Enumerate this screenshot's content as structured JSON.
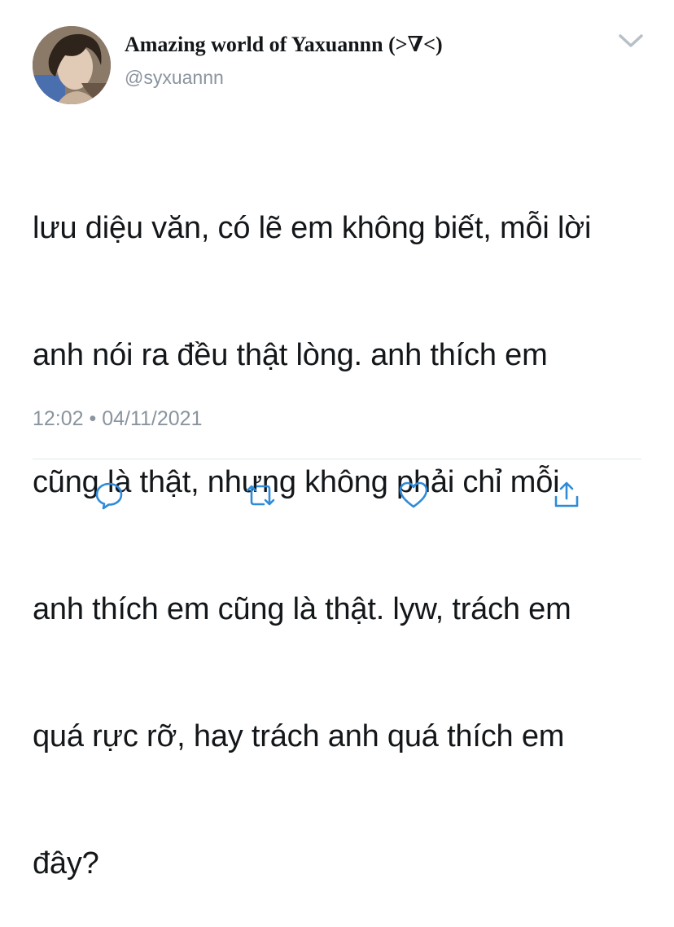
{
  "tweet": {
    "author": {
      "display_name": "Amazing world of Yaxuannn (>∇<)",
      "handle": "@syxuannn",
      "avatar": "avatar-photo"
    },
    "text_lines": [
      "lưu diệu văn, có lẽ em không biết, mỗi lời",
      "anh nói ra đều thật lòng. anh thích em",
      "cũng là thật, nhưng không phải chỉ mỗi",
      "anh thích em cũng là thật. lyw, trách em",
      "quá rực rỡ, hay trách anh quá thích em",
      "đây?"
    ],
    "timestamp": "12:02 • 04/11/2021"
  },
  "icons": {
    "menu": "chevron-down-icon",
    "reply": "reply-icon",
    "retweet": "retweet-icon",
    "like": "heart-icon",
    "share": "share-icon"
  },
  "colors": {
    "text": "#14171a",
    "secondary": "#8a949e",
    "icon": "#2f8bd8",
    "divider": "#e1e8ed"
  }
}
